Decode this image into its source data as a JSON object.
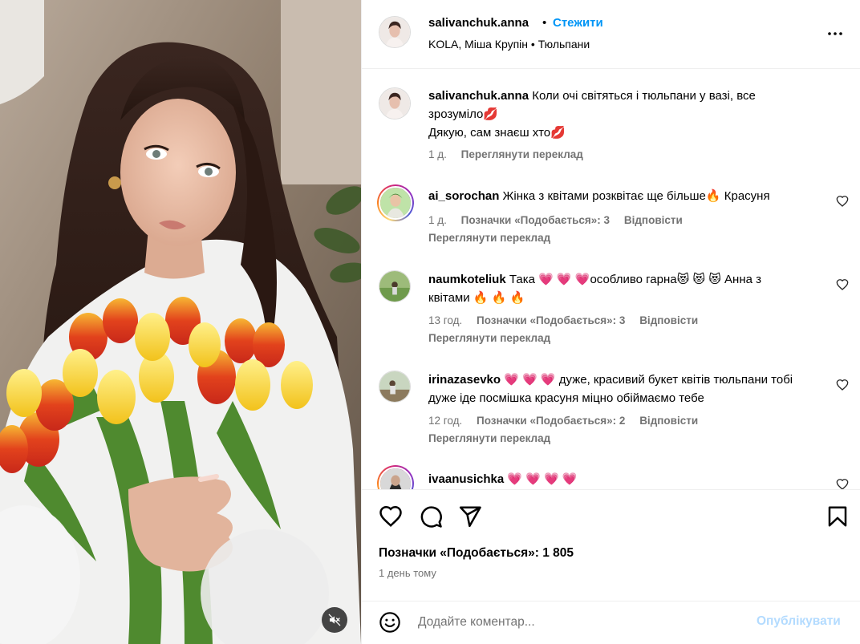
{
  "header": {
    "username": "salivanchuk.anna",
    "separator": "•",
    "follow_label": "Стежити",
    "audio": "KOLA, Міша Крупін • Тюльпани"
  },
  "caption": {
    "username": "salivanchuk.anna",
    "line1": "Коли очі світяться і тюльпани у вазі, все зрозуміло💋",
    "line2": "Дякую, сам знаєш хто💋",
    "time": "1 д.",
    "translate": "Переглянути переклад"
  },
  "comments": [
    {
      "username": "ai_sorochan",
      "text": "Жінка з квітами розквітає ще більше🔥 Красуня",
      "time": "1 д.",
      "likes": "Позначки «Подобається»: 3",
      "reply": "Відповісти",
      "translate": "Переглянути переклад"
    },
    {
      "username": "naumkoteliuk",
      "text": "Така 💗 💗 💗особливо гарна😻 😻 😻 Анна з квітами 🔥 🔥 🔥",
      "time": "13 год.",
      "likes": "Позначки «Подобається»: 3",
      "reply": "Відповісти",
      "translate": "Переглянути переклад"
    },
    {
      "username": "irinazasevko",
      "text": "💗 💗 💗 дуже, красивий букет квітів тюльпани тобі дуже іде посмішка красуня міцно обіймаємо тебе",
      "time": "12 год.",
      "likes": "Позначки «Подобається»: 2",
      "reply": "Відповісти",
      "translate": "Переглянути переклад"
    },
    {
      "username": "ivaanusichka",
      "text": "💗 💗 💗 💗"
    }
  ],
  "actions": {
    "likes_count": "Позначки «Подобається»: 1 805",
    "posted": "1 день тому",
    "icons": [
      "heart-icon",
      "comment-icon",
      "share-icon",
      "save-icon"
    ]
  },
  "composer": {
    "placeholder": "Додайте коментар...",
    "publish_label": "Опублікувати"
  },
  "colors": {
    "accent": "#0095f6",
    "publish_disabled": "#b3dbff",
    "secondary_text": "#737373"
  }
}
